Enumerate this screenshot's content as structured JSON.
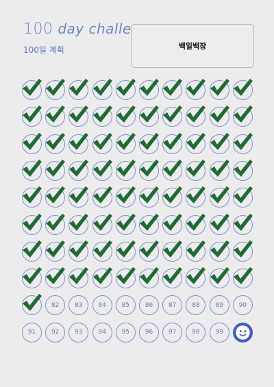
{
  "header": {
    "title_num": "100",
    "title_text": " day challenge",
    "subtitle": "100일 계획",
    "goal": "백일백장"
  },
  "colors": {
    "check": "#1e6b35",
    "circle": "#7f8fcc",
    "number": "#6578b8",
    "title": "#6a86c2"
  },
  "grid": {
    "total": 100,
    "checked_through": 81,
    "columns": 10,
    "last_cell_icon": "smiley-face-icon"
  },
  "numbers": [
    "82",
    "83",
    "84",
    "85",
    "86",
    "87",
    "88",
    "89",
    "90",
    "91",
    "92",
    "93",
    "94",
    "95",
    "96",
    "97",
    "98",
    "99"
  ]
}
